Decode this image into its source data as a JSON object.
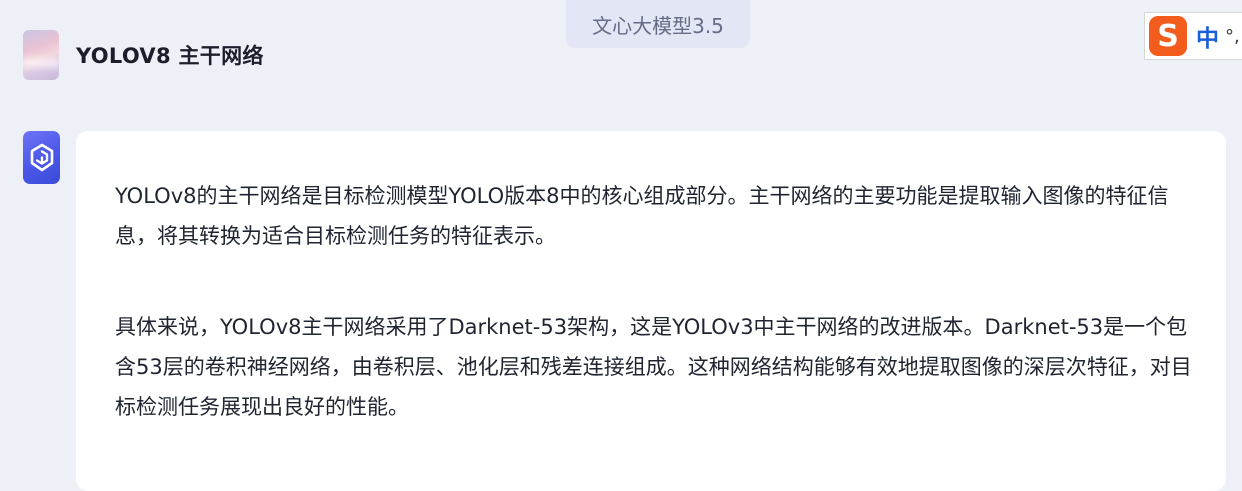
{
  "header": {
    "model_tab_label": "文心大模型3.5"
  },
  "ime": {
    "logo_letter": "S",
    "mode_label": "中",
    "punct_label": "°,"
  },
  "user_message": {
    "text": "YOLOV8 主干网络"
  },
  "bot_message": {
    "paragraphs": [
      "YOLOv8的主干网络是目标检测模型YOLO版本8中的核心组成部分。主干网络的主要功能是提取输入图像的特征信息，将其转换为适合目标检测任务的特征表示。",
      "具体来说，YOLOv8主干网络采用了Darknet-53架构，这是YOLOv3中主干网络的改进版本。Darknet-53是一个包含53层的卷积神经网络，由卷积层、池化层和残差连接组成。这种网络结构能够有效地提取图像的深层次特征，对目标检测任务展现出良好的性能。"
    ]
  },
  "colors": {
    "page_background": "#eef0f7",
    "card_background": "#ffffff",
    "bot_avatar": "#4a57e8",
    "ime_logo": "#f25c1c"
  },
  "icons": {
    "bot_avatar": "ernie-bot-logo-icon",
    "user_avatar": "user-avatar-image"
  }
}
